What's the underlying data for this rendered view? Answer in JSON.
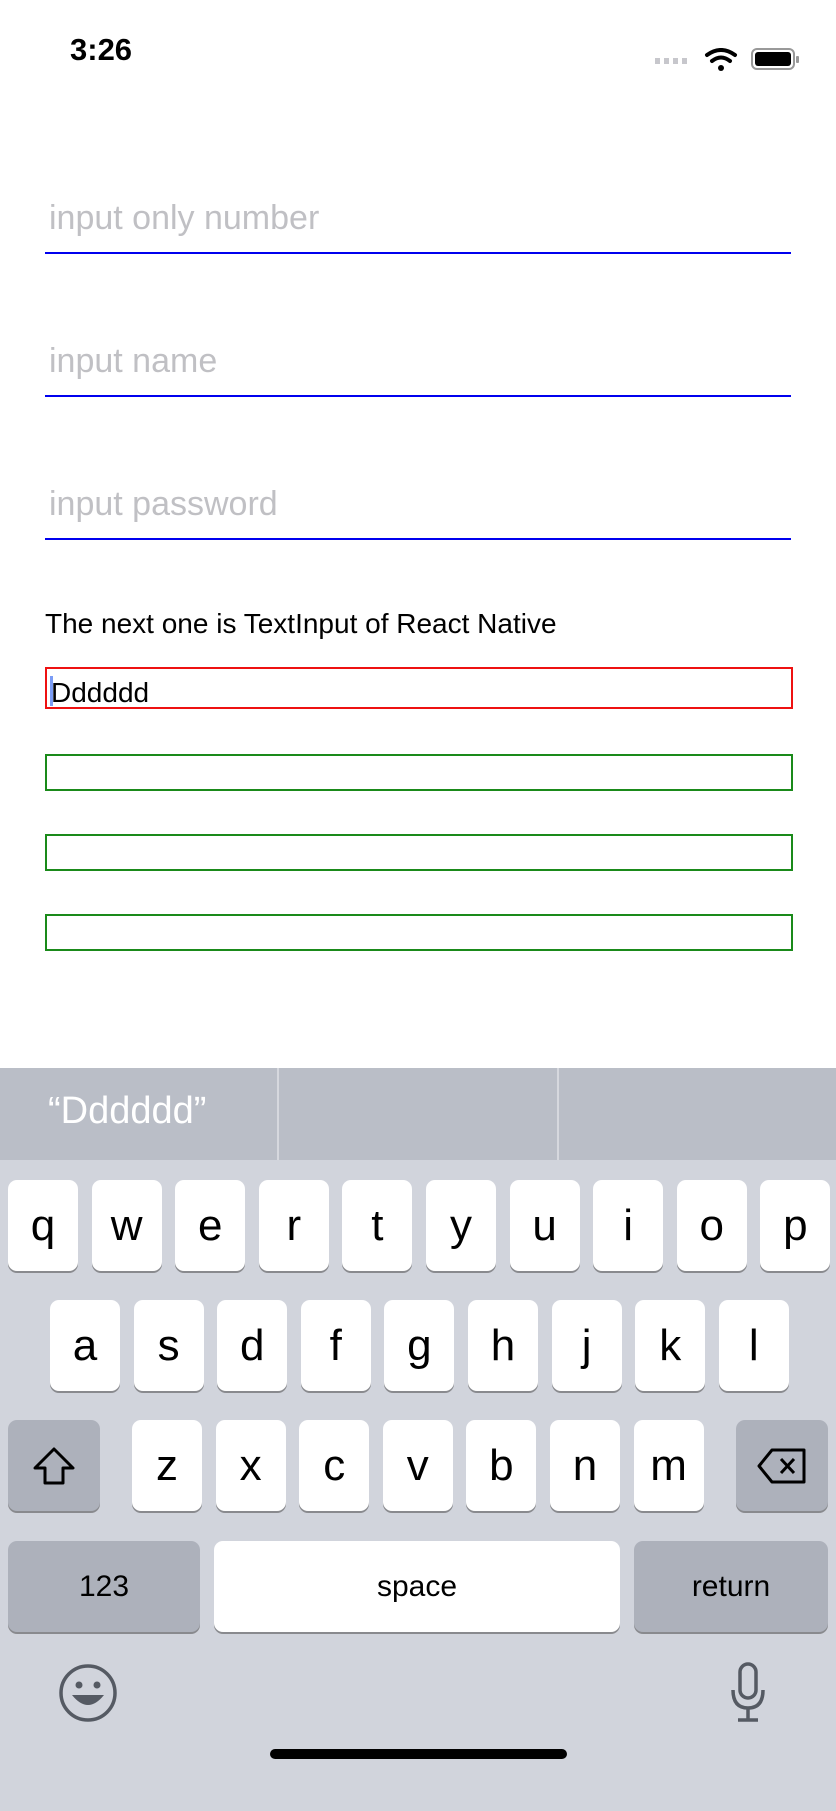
{
  "status_bar": {
    "time": "3:26",
    "icons": [
      "signal-icon",
      "wifi-icon",
      "battery-icon"
    ]
  },
  "fields": [
    {
      "placeholder": "input only number",
      "value": ""
    },
    {
      "placeholder": "input name",
      "value": ""
    },
    {
      "placeholder": "input password",
      "value": ""
    }
  ],
  "label": "The next one is TextInput of React Native",
  "rn_input": {
    "value": "Dddddd",
    "border_color": "#ee1111"
  },
  "green_inputs": [
    "",
    "",
    ""
  ],
  "colors": {
    "underline": "#0000ee",
    "green_border": "#1a8a1a",
    "keyboard_bg": "#d1d4dc"
  },
  "keyboard": {
    "suggestion": "“Dddddd”",
    "row1": [
      "q",
      "w",
      "e",
      "r",
      "t",
      "y",
      "u",
      "i",
      "o",
      "p"
    ],
    "row2": [
      "a",
      "s",
      "d",
      "f",
      "g",
      "h",
      "j",
      "k",
      "l"
    ],
    "row3": [
      "z",
      "x",
      "c",
      "v",
      "b",
      "n",
      "m"
    ],
    "numbers_label": "123",
    "space_label": "space",
    "return_label": "return"
  }
}
